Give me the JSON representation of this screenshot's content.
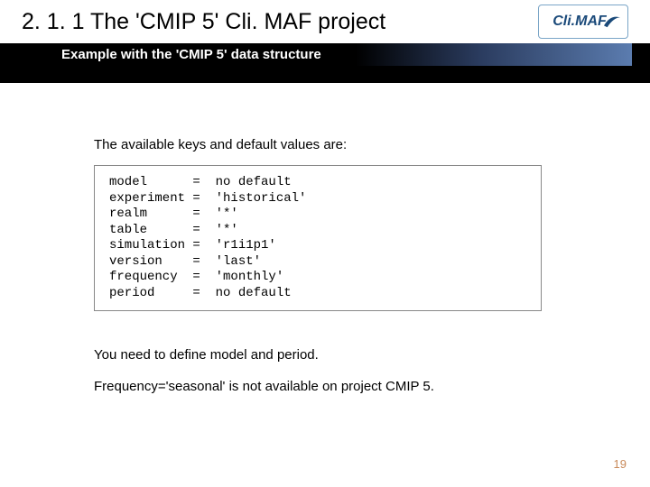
{
  "header": {
    "title": "2. 1. 1 The 'CMIP 5' Cli. MAF project",
    "subtitle": "Example with the 'CMIP 5' data structure",
    "logo_text": "Cli.MAF"
  },
  "content": {
    "intro": "The available keys and default values are:",
    "code": "model      =  no default\nexperiment =  'historical'\nrealm      =  '*'\ntable      =  '*'\nsimulation =  'r1i1p1'\nversion    =  'last'\nfrequency  =  'monthly'\nperiod     =  no default",
    "note1": "You need to define model and period.",
    "note2": "Frequency='seasonal' is not available on project CMIP 5."
  },
  "page_number": "19"
}
